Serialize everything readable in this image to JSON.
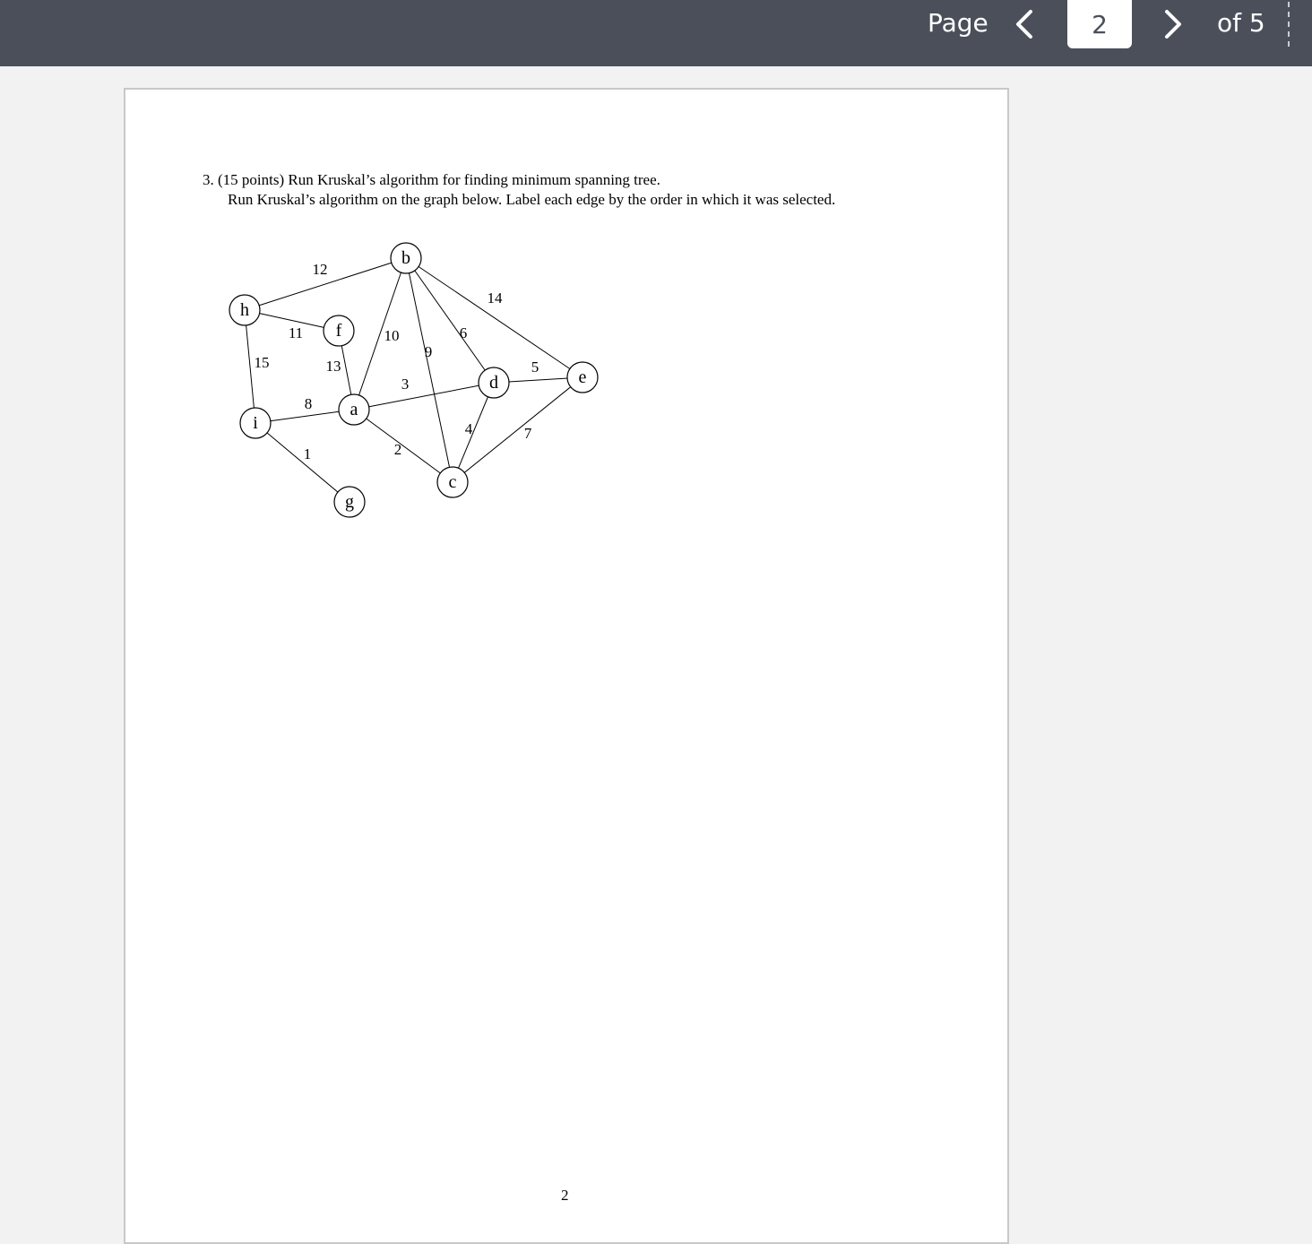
{
  "toolbar": {
    "page_label": "Page",
    "current_page": "2",
    "of_label": "of 5",
    "prev_icon": "chevron-left-icon",
    "next_icon": "chevron-right-icon",
    "color": "#4a4f5a"
  },
  "document": {
    "question_line_1": "3. (15 points) Run Kruskal’s algorithm for finding minimum spanning tree.",
    "question_line_2": "Run Kruskal’s algorithm on the graph below. Label each edge by the order in which it was selected.",
    "page_number": "2"
  },
  "graph": {
    "nodes": [
      "b",
      "h",
      "f",
      "a",
      "d",
      "e",
      "i",
      "c",
      "g"
    ],
    "edges": [
      {
        "from": "h",
        "to": "b",
        "weight": "12"
      },
      {
        "from": "b",
        "to": "e",
        "weight": "14"
      },
      {
        "from": "h",
        "to": "f",
        "weight": "11"
      },
      {
        "from": "b",
        "to": "a",
        "weight": "10"
      },
      {
        "from": "b",
        "to": "c",
        "weight": "9"
      },
      {
        "from": "b",
        "to": "d",
        "weight": "6"
      },
      {
        "from": "h",
        "to": "i",
        "weight": "15"
      },
      {
        "from": "f",
        "to": "a",
        "weight": "13"
      },
      {
        "from": "a",
        "to": "d",
        "weight": "3"
      },
      {
        "from": "d",
        "to": "e",
        "weight": "5"
      },
      {
        "from": "i",
        "to": "a",
        "weight": "8"
      },
      {
        "from": "d",
        "to": "c",
        "weight": "4"
      },
      {
        "from": "c",
        "to": "e",
        "weight": "7"
      },
      {
        "from": "i",
        "to": "g",
        "weight": "1"
      },
      {
        "from": "a",
        "to": "c",
        "weight": "2"
      }
    ]
  }
}
